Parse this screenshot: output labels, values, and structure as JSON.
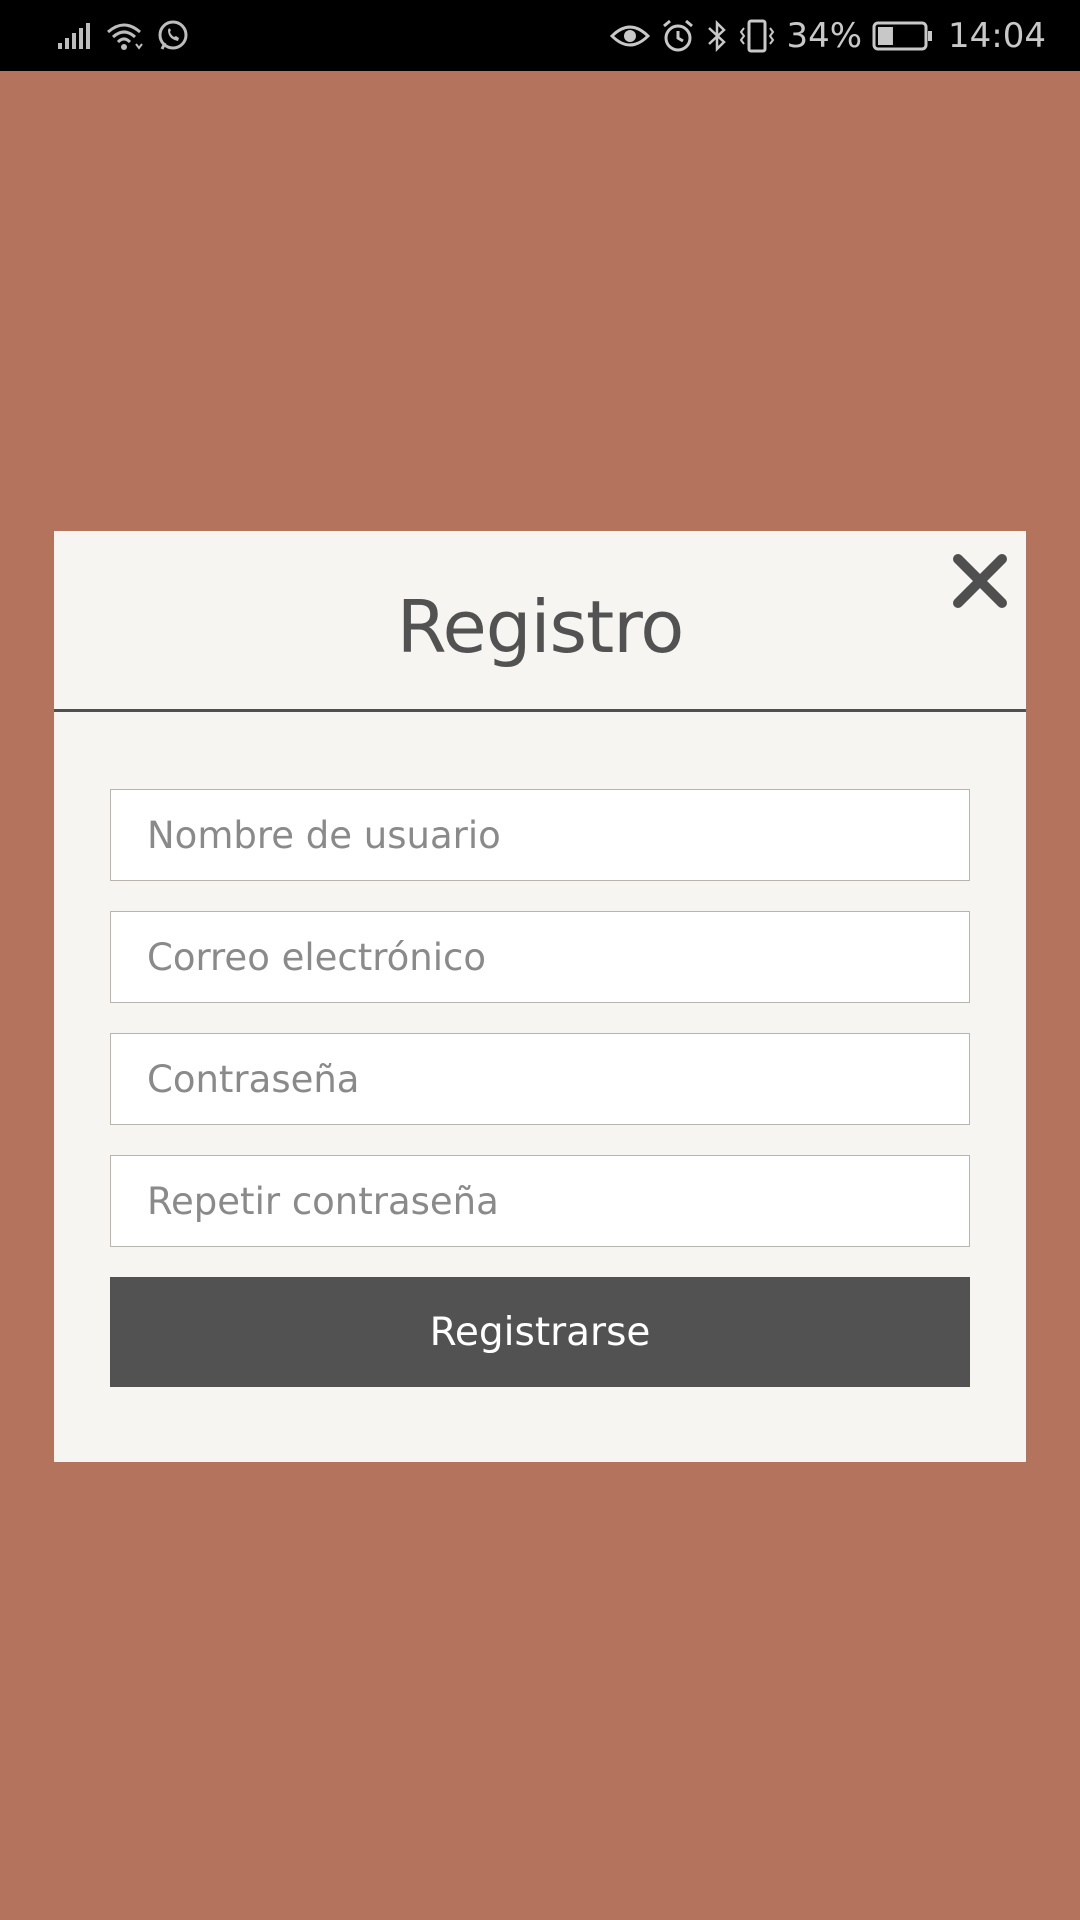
{
  "status_bar": {
    "battery_percent": "34%",
    "time": "14:04",
    "icons": [
      "signal-icon",
      "wifi-icon",
      "whatsapp-icon",
      "eye-icon",
      "alarm-icon",
      "bluetooth-icon",
      "vibrate-icon",
      "battery-icon"
    ],
    "battery_level": 0.34
  },
  "modal": {
    "title": "Registro",
    "close_icon": "close-icon",
    "fields": {
      "username_placeholder": "Nombre de usuario",
      "email_placeholder": "Correo electrónico",
      "password_placeholder": "Contraseña",
      "repeat_password_placeholder": "Repetir contraseña"
    },
    "submit_label": "Registrarse"
  },
  "colors": {
    "background": "#b3735c",
    "modal_background": "#f6f5f1",
    "button": "#525252",
    "text_dark": "#525252"
  }
}
